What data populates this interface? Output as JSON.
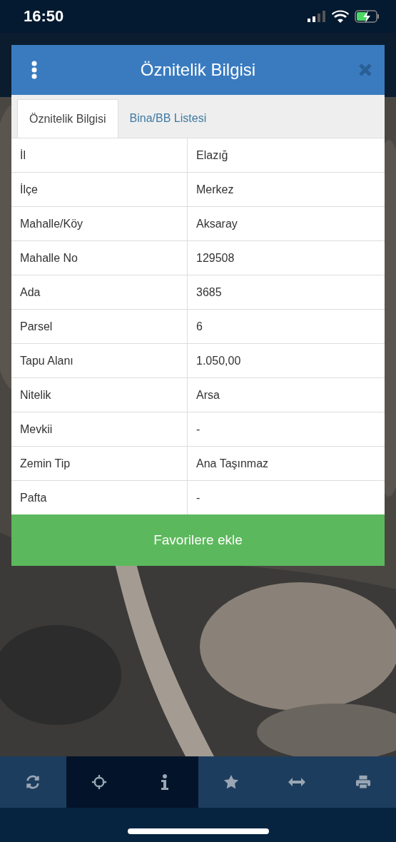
{
  "status_bar": {
    "time": "16:50"
  },
  "dialog": {
    "title": "Öznitelik Bilgisi",
    "tabs": [
      {
        "label": "Öznitelik Bilgisi",
        "selected": true
      },
      {
        "label": "Bina/BB Listesi",
        "selected": false
      }
    ],
    "rows": [
      {
        "label": "İl",
        "value": "Elazığ"
      },
      {
        "label": "İlçe",
        "value": "Merkez"
      },
      {
        "label": "Mahalle/Köy",
        "value": "Aksaray"
      },
      {
        "label": "Mahalle No",
        "value": "129508"
      },
      {
        "label": "Ada",
        "value": "3685"
      },
      {
        "label": "Parsel",
        "value": "6"
      },
      {
        "label": "Tapu Alanı",
        "value": "1.050,00"
      },
      {
        "label": "Nitelik",
        "value": "Arsa"
      },
      {
        "label": "Mevkii",
        "value": "-"
      },
      {
        "label": "Zemin Tip",
        "value": "Ana Taşınmaz"
      },
      {
        "label": "Pafta",
        "value": "-"
      }
    ],
    "button": "Favorilere ekle"
  },
  "toolbar": [
    {
      "kind": "refresh",
      "selected": false
    },
    {
      "kind": "locate",
      "selected": true
    },
    {
      "kind": "info",
      "selected": true
    },
    {
      "kind": "favorite",
      "selected": false
    },
    {
      "kind": "measure",
      "selected": false
    },
    {
      "kind": "print",
      "selected": false
    }
  ]
}
